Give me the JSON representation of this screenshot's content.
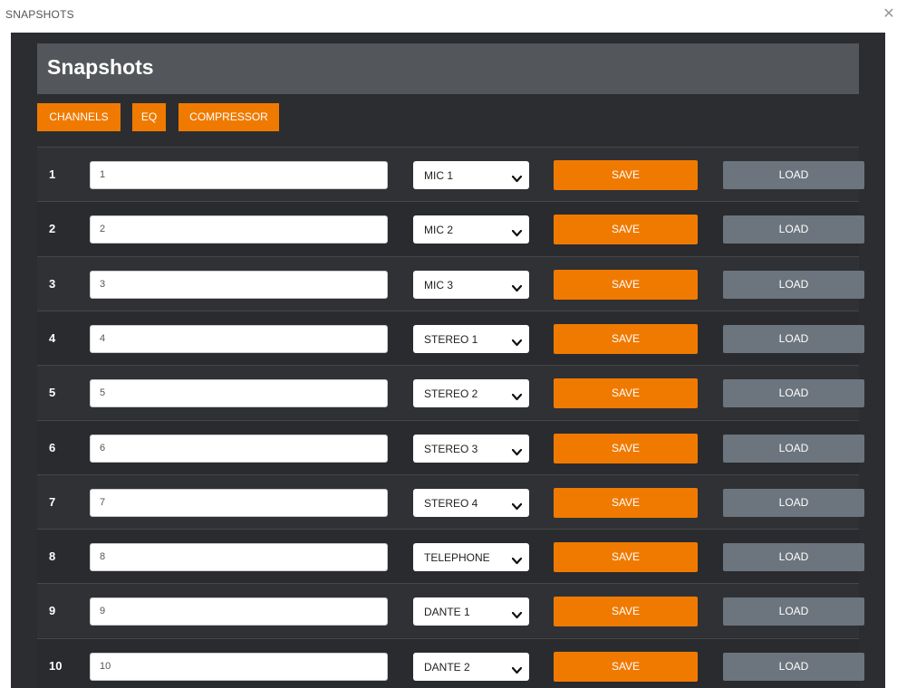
{
  "window": {
    "title": "SNAPSHOTS",
    "close_glyph": "✕"
  },
  "header": {
    "title": "Snapshots"
  },
  "tabs": [
    "CHANNELS",
    "EQ",
    "COMPRESSOR"
  ],
  "actions": {
    "save_label": "SAVE",
    "load_label": "LOAD"
  },
  "snapshots": [
    {
      "number": "1",
      "name": "1",
      "channel": "MIC 1"
    },
    {
      "number": "2",
      "name": "2",
      "channel": "MIC 2"
    },
    {
      "number": "3",
      "name": "3",
      "channel": "MIC 3"
    },
    {
      "number": "4",
      "name": "4",
      "channel": "STEREO 1"
    },
    {
      "number": "5",
      "name": "5",
      "channel": "STEREO 2"
    },
    {
      "number": "6",
      "name": "6",
      "channel": "STEREO 3"
    },
    {
      "number": "7",
      "name": "7",
      "channel": "STEREO 4"
    },
    {
      "number": "8",
      "name": "8",
      "channel": "TELEPHONE"
    },
    {
      "number": "9",
      "name": "9",
      "channel": "DANTE 1"
    },
    {
      "number": "10",
      "name": "10",
      "channel": "DANTE 2"
    }
  ],
  "colors": {
    "accent": "#f07a00",
    "load_button": "#6c757d",
    "panel": "#2b2d31",
    "header": "#53565a"
  },
  "icons": {
    "close": "close-icon",
    "dropdown": "chevron-down-icon"
  }
}
